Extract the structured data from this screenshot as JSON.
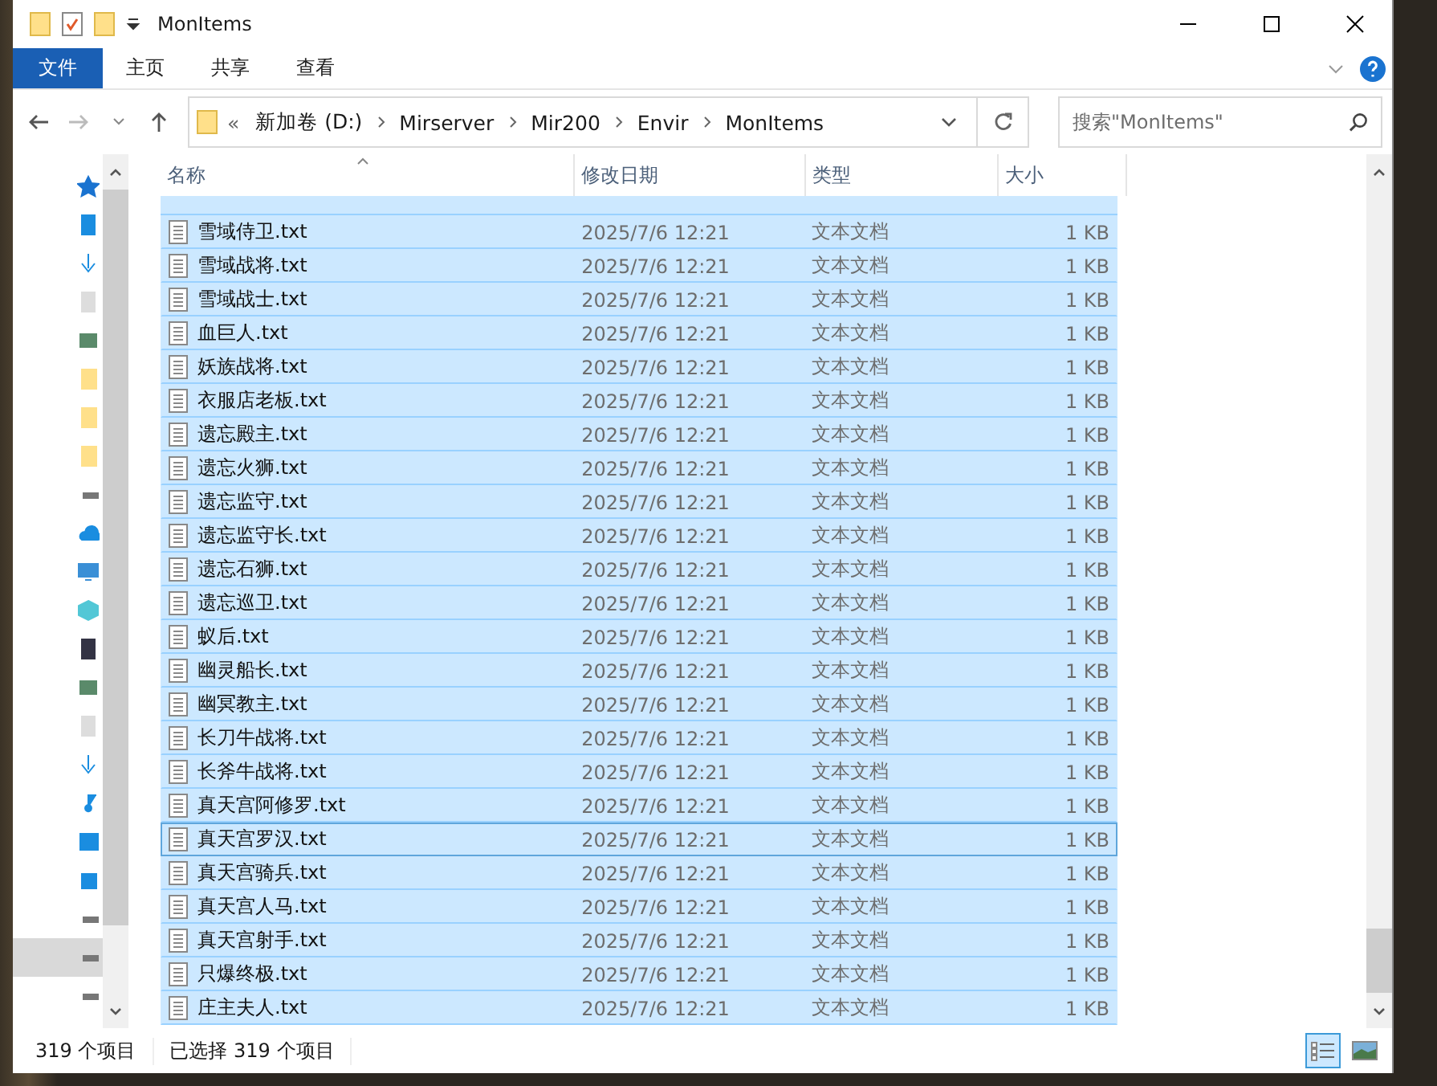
{
  "window": {
    "title": "MonItems"
  },
  "ribbon_tabs": [
    {
      "label": "文件",
      "kind": "file"
    },
    {
      "label": "主页",
      "kind": "tab"
    },
    {
      "label": "共享",
      "kind": "tab"
    },
    {
      "label": "查看",
      "kind": "tab"
    }
  ],
  "address": {
    "overflow": "«",
    "segments": [
      "新加卷 (D:)",
      "Mirserver",
      "Mir200",
      "Envir",
      "MonItems"
    ]
  },
  "search": {
    "placeholder": "搜索\"MonItems\""
  },
  "columns": [
    "名称",
    "修改日期",
    "类型",
    "大小"
  ],
  "rows": [
    {
      "name": "雪域侍卫.txt",
      "date": "2025/7/6 12:21",
      "type": "文本文档",
      "size": "1 KB",
      "selected": true,
      "focused": false
    },
    {
      "name": "雪域战将.txt",
      "date": "2025/7/6 12:21",
      "type": "文本文档",
      "size": "1 KB",
      "selected": true,
      "focused": false
    },
    {
      "name": "雪域战士.txt",
      "date": "2025/7/6 12:21",
      "type": "文本文档",
      "size": "1 KB",
      "selected": true,
      "focused": false
    },
    {
      "name": "血巨人.txt",
      "date": "2025/7/6 12:21",
      "type": "文本文档",
      "size": "1 KB",
      "selected": true,
      "focused": false
    },
    {
      "name": "妖族战将.txt",
      "date": "2025/7/6 12:21",
      "type": "文本文档",
      "size": "1 KB",
      "selected": true,
      "focused": false
    },
    {
      "name": "衣服店老板.txt",
      "date": "2025/7/6 12:21",
      "type": "文本文档",
      "size": "1 KB",
      "selected": true,
      "focused": false
    },
    {
      "name": "遗忘殿主.txt",
      "date": "2025/7/6 12:21",
      "type": "文本文档",
      "size": "1 KB",
      "selected": true,
      "focused": false
    },
    {
      "name": "遗忘火狮.txt",
      "date": "2025/7/6 12:21",
      "type": "文本文档",
      "size": "1 KB",
      "selected": true,
      "focused": false
    },
    {
      "name": "遗忘监守.txt",
      "date": "2025/7/6 12:21",
      "type": "文本文档",
      "size": "1 KB",
      "selected": true,
      "focused": false
    },
    {
      "name": "遗忘监守长.txt",
      "date": "2025/7/6 12:21",
      "type": "文本文档",
      "size": "1 KB",
      "selected": true,
      "focused": false
    },
    {
      "name": "遗忘石狮.txt",
      "date": "2025/7/6 12:21",
      "type": "文本文档",
      "size": "1 KB",
      "selected": true,
      "focused": false
    },
    {
      "name": "遗忘巡卫.txt",
      "date": "2025/7/6 12:21",
      "type": "文本文档",
      "size": "1 KB",
      "selected": true,
      "focused": false
    },
    {
      "name": "蚁后.txt",
      "date": "2025/7/6 12:21",
      "type": "文本文档",
      "size": "1 KB",
      "selected": true,
      "focused": false
    },
    {
      "name": "幽灵船长.txt",
      "date": "2025/7/6 12:21",
      "type": "文本文档",
      "size": "1 KB",
      "selected": true,
      "focused": false
    },
    {
      "name": "幽冥教主.txt",
      "date": "2025/7/6 12:21",
      "type": "文本文档",
      "size": "1 KB",
      "selected": true,
      "focused": false
    },
    {
      "name": "长刀牛战将.txt",
      "date": "2025/7/6 12:21",
      "type": "文本文档",
      "size": "1 KB",
      "selected": true,
      "focused": false
    },
    {
      "name": "长斧牛战将.txt",
      "date": "2025/7/6 12:21",
      "type": "文本文档",
      "size": "1 KB",
      "selected": true,
      "focused": false
    },
    {
      "name": "真天宫阿修罗.txt",
      "date": "2025/7/6 12:21",
      "type": "文本文档",
      "size": "1 KB",
      "selected": true,
      "focused": false
    },
    {
      "name": "真天宫罗汉.txt",
      "date": "2025/7/6 12:21",
      "type": "文本文档",
      "size": "1 KB",
      "selected": true,
      "focused": true
    },
    {
      "name": "真天宫骑兵.txt",
      "date": "2025/7/6 12:21",
      "type": "文本文档",
      "size": "1 KB",
      "selected": true,
      "focused": false
    },
    {
      "name": "真天宫人马.txt",
      "date": "2025/7/6 12:21",
      "type": "文本文档",
      "size": "1 KB",
      "selected": true,
      "focused": false
    },
    {
      "name": "真天宫射手.txt",
      "date": "2025/7/6 12:21",
      "type": "文本文档",
      "size": "1 KB",
      "selected": true,
      "focused": false
    },
    {
      "name": "只爆终极.txt",
      "date": "2025/7/6 12:21",
      "type": "文本文档",
      "size": "1 KB",
      "selected": true,
      "focused": false
    },
    {
      "name": "庄主夫人.txt",
      "date": "2025/7/6 12:21",
      "type": "文本文档",
      "size": "1 KB",
      "selected": true,
      "focused": false
    }
  ],
  "status_bar": {
    "count": "319 个项目",
    "selection": "已选择 319 个项目"
  },
  "views": [
    {
      "kind": "details",
      "selected": true
    },
    {
      "kind": "thumbnails",
      "selected": false
    }
  ]
}
